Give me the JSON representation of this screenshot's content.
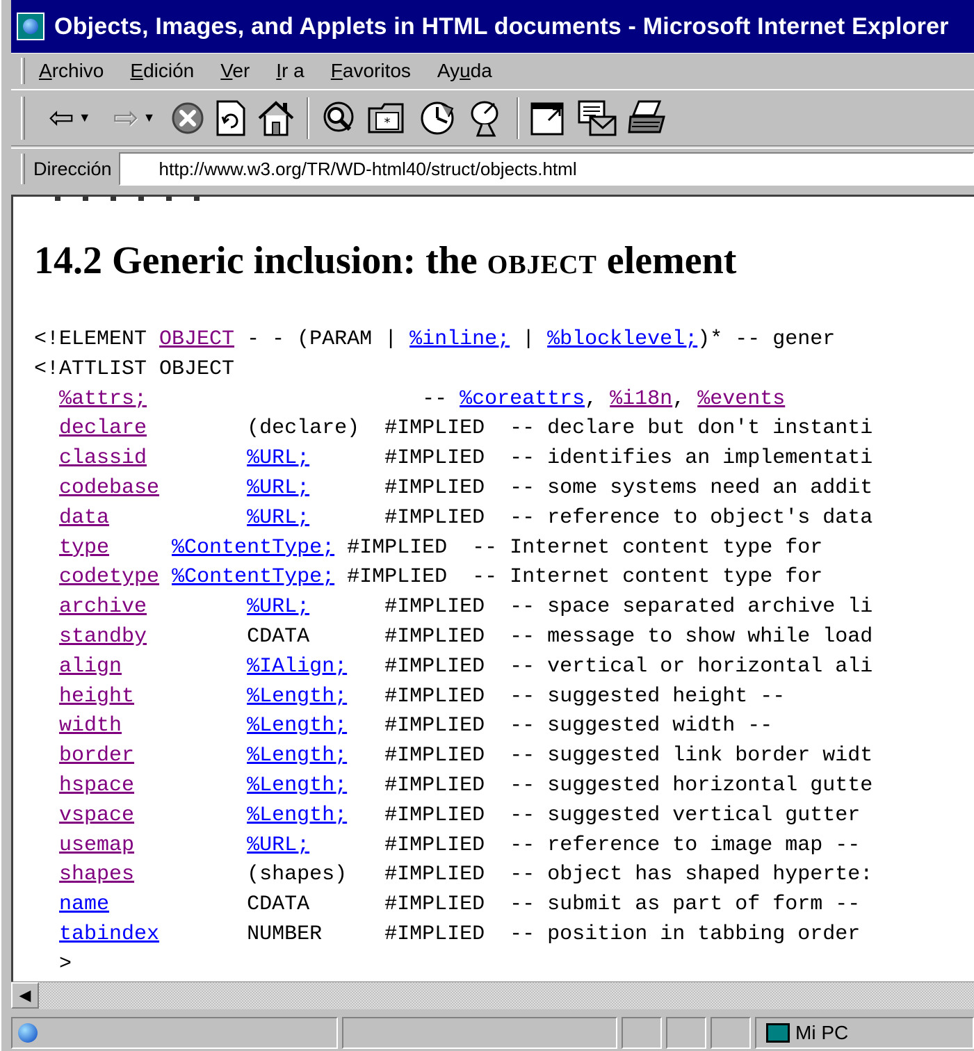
{
  "window": {
    "title": "Objects, Images, and Applets in HTML documents - Microsoft Internet Explorer"
  },
  "menubar": {
    "items": [
      {
        "pre": "",
        "key": "A",
        "post": "rchivo"
      },
      {
        "pre": "",
        "key": "E",
        "post": "dición"
      },
      {
        "pre": "",
        "key": "V",
        "post": "er"
      },
      {
        "pre": "",
        "key": "I",
        "post": "r a"
      },
      {
        "pre": "",
        "key": "F",
        "post": "avoritos"
      },
      {
        "pre": "Ay",
        "key": "u",
        "post": "da"
      }
    ]
  },
  "toolbar": {
    "icons": [
      "back-icon",
      "forward-icon",
      "stop-icon",
      "refresh-icon",
      "home-icon",
      "search-icon",
      "favorites-icon",
      "history-icon",
      "channels-icon",
      "fullscreen-icon",
      "mail-icon",
      "print-icon"
    ]
  },
  "addressbar": {
    "label": "Dirección",
    "url": "http://www.w3.org/TR/WD-html40/struct/objects.html"
  },
  "content": {
    "heading_prefix": "14.2 Generic inclusion: the ",
    "heading_element": "OBJECT",
    "heading_suffix": " element",
    "decl": {
      "l1_a": "<!ELEMENT ",
      "l1_link": "OBJECT",
      "l1_b": " - - (PARAM | ",
      "l1_link2": "%inline;",
      "l1_c": " | ",
      "l1_link3": "%blocklevel;",
      "l1_d": ")* -- gener",
      "l2": "<!ATTLIST OBJECT",
      "attrs_pad": "                      -- ",
      "coreattrs": "%coreattrs",
      "comma1": ", ",
      "i18n": "%i18n",
      "comma2": ", ",
      "events": "%events",
      "close": ">"
    },
    "attrs_link": "%attrs;",
    "rows": [
      {
        "name": "declare",
        "name_visited": true,
        "type": "(declare)",
        "type_link": false,
        "default": "#IMPLIED",
        "comment": "-- declare but don't instanti"
      },
      {
        "name": "classid",
        "name_visited": true,
        "type": "%URL;",
        "type_link": true,
        "default": "#IMPLIED",
        "comment": "-- identifies an implementati"
      },
      {
        "name": "codebase",
        "name_visited": true,
        "type": "%URL;",
        "type_link": true,
        "default": "#IMPLIED",
        "comment": "-- some systems need an addit"
      },
      {
        "name": "data",
        "name_visited": true,
        "type": "%URL;",
        "type_link": true,
        "default": "#IMPLIED",
        "comment": "-- reference to object's data"
      },
      {
        "name": "type",
        "name_visited": true,
        "type": "%ContentType;",
        "type_link": true,
        "default": "#IMPLIED",
        "comment": "-- Internet content type for "
      },
      {
        "name": "codetype",
        "name_visited": true,
        "type": "%ContentType;",
        "type_link": true,
        "default": "#IMPLIED",
        "comment": "-- Internet content type for "
      },
      {
        "name": "archive",
        "name_visited": true,
        "type": "%URL;",
        "type_link": true,
        "default": "#IMPLIED",
        "comment": "-- space separated archive li"
      },
      {
        "name": "standby",
        "name_visited": true,
        "type": "CDATA",
        "type_link": false,
        "default": "#IMPLIED",
        "comment": "-- message to show while load"
      },
      {
        "name": "align",
        "name_visited": true,
        "type": "%IAlign;",
        "type_link": true,
        "default": "#IMPLIED",
        "comment": "-- vertical or horizontal ali"
      },
      {
        "name": "height",
        "name_visited": true,
        "type": "%Length;",
        "type_link": true,
        "default": "#IMPLIED",
        "comment": "-- suggested height --"
      },
      {
        "name": "width",
        "name_visited": true,
        "type": "%Length;",
        "type_link": true,
        "default": "#IMPLIED",
        "comment": "-- suggested width --"
      },
      {
        "name": "border",
        "name_visited": true,
        "type": "%Length;",
        "type_link": true,
        "default": "#IMPLIED",
        "comment": "-- suggested link border widt"
      },
      {
        "name": "hspace",
        "name_visited": true,
        "type": "%Length;",
        "type_link": true,
        "default": "#IMPLIED",
        "comment": "-- suggested horizontal gutte"
      },
      {
        "name": "vspace",
        "name_visited": true,
        "type": "%Length;",
        "type_link": true,
        "default": "#IMPLIED",
        "comment": "-- suggested vertical gutter "
      },
      {
        "name": "usemap",
        "name_visited": true,
        "type": "%URL;",
        "type_link": true,
        "default": "#IMPLIED",
        "comment": "-- reference to image map -- "
      },
      {
        "name": "shapes",
        "name_visited": true,
        "type": "(shapes)",
        "type_link": false,
        "default": "#IMPLIED",
        "comment": "-- object has shaped hyperte:"
      },
      {
        "name": "name",
        "name_visited": false,
        "type": "CDATA",
        "type_link": false,
        "default": "#IMPLIED",
        "comment": "-- submit as part of form -- "
      },
      {
        "name": "tabindex",
        "name_visited": false,
        "type": "NUMBER",
        "type_link": false,
        "default": "#IMPLIED",
        "comment": "-- position in tabbing order "
      }
    ]
  },
  "statusbar": {
    "zone_label": "Mi PC"
  },
  "colors": {
    "titlebar": "#000080",
    "visited_link": "#800080",
    "link": "#0000ff",
    "chrome": "#c0c0c0"
  }
}
